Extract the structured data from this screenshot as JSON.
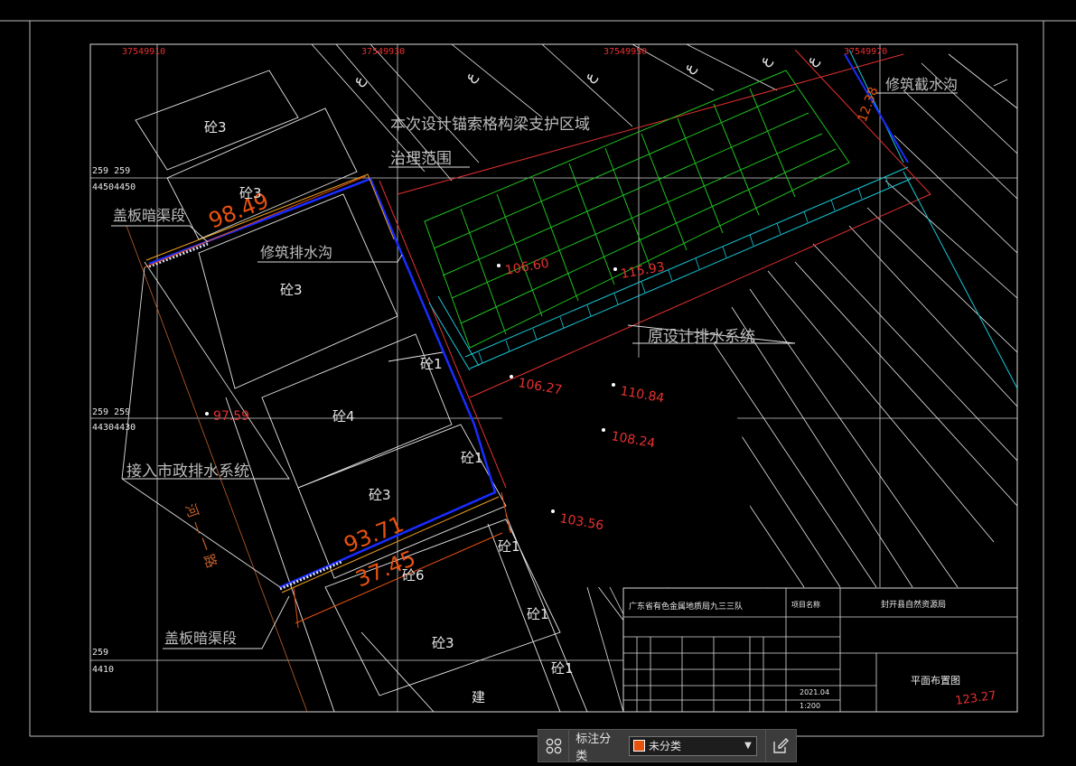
{
  "drawing": {
    "grid_x_labels": [
      "37549910",
      "37549930",
      "37549950",
      "37549970"
    ],
    "grid_y_labels": [
      {
        "top": "259  259",
        "bottom": "44504450"
      },
      {
        "top": "259  259",
        "bottom": "44304430"
      },
      {
        "top": "259",
        "bottom": "4410"
      }
    ],
    "annotations": {
      "anchor_area": "本次设计锚索格构梁支护区域",
      "treatment_scope": "治理范围",
      "intercept_ditch": "修筑截水沟",
      "covered_culvert_top": "盖板暗渠段",
      "covered_culvert_bottom": "盖板暗渠段",
      "drainage_ditch": "修筑排水沟",
      "original_drainage": "原设计排水系统",
      "municipal_drainage": "接入市政排水系统",
      "road": "河 —  一 路"
    },
    "dimensions": {
      "top_length": "98.49",
      "bottom_length": "93.71",
      "bottom_elev": "37.45",
      "right_small": "12.38"
    },
    "elevations": [
      "106.60",
      "115.93",
      "106.27",
      "110.84",
      "108.24",
      "103.56",
      "97.59"
    ],
    "land_labels": [
      "砼3",
      "砼3",
      "砼3",
      "砼1",
      "砼4",
      "砼1",
      "砼3",
      "砼1",
      "砼6",
      "砼1",
      "砼3",
      "砼1",
      "建"
    ],
    "contour_labels": [
      "ع",
      "ع",
      "ع",
      "ع",
      "ع",
      "ع"
    ],
    "title_block": {
      "company": "广东省有色金属地质局九三三队",
      "project_label": "项目名称",
      "project_name": "封开县自然资源局",
      "drawing_title": "平面布置图",
      "date": "2021.04",
      "scale": "1:200",
      "elev_red": "123.27"
    }
  },
  "toolbar": {
    "category_label": "标注分类",
    "category_value": "未分类",
    "swatch_color": "#e8520f"
  }
}
